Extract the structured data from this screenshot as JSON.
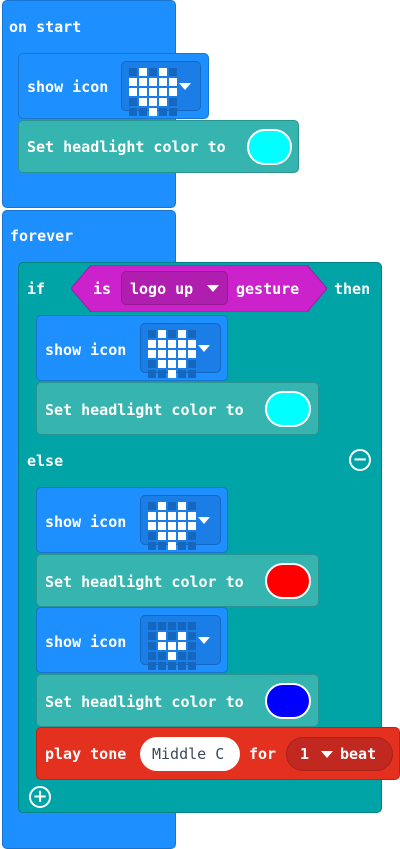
{
  "on_start": {
    "label": "on start",
    "show_icon": {
      "label": "show icon",
      "icon": "heart",
      "pattern": [
        0,
        1,
        0,
        1,
        0,
        1,
        1,
        1,
        1,
        1,
        1,
        1,
        1,
        1,
        1,
        0,
        1,
        1,
        1,
        0,
        0,
        0,
        1,
        0,
        0
      ]
    },
    "set_headlight": {
      "label": "Set headlight color to",
      "color": "#00ffff"
    }
  },
  "forever": {
    "label": "forever",
    "if_block": {
      "if_label": "if",
      "then_label": "then",
      "else_label": "else",
      "condition": {
        "is_label": "is",
        "gesture_value": "logo up",
        "gesture_label": "gesture"
      },
      "then_body": [
        {
          "show_icon": {
            "label": "show icon",
            "icon": "heart",
            "pattern": [
              0,
              1,
              0,
              1,
              0,
              1,
              1,
              1,
              1,
              1,
              1,
              1,
              1,
              1,
              1,
              0,
              1,
              1,
              1,
              0,
              0,
              0,
              1,
              0,
              0
            ]
          }
        },
        {
          "set_headlight": {
            "label": "Set headlight color to",
            "color": "#00ffff"
          }
        }
      ],
      "else_body": [
        {
          "show_icon": {
            "label": "show icon",
            "icon": "heart",
            "pattern": [
              0,
              1,
              0,
              1,
              0,
              1,
              1,
              1,
              1,
              1,
              1,
              1,
              1,
              1,
              1,
              0,
              1,
              1,
              1,
              0,
              0,
              0,
              1,
              0,
              0
            ]
          }
        },
        {
          "set_headlight": {
            "label": "Set headlight color to",
            "color": "#ff0000"
          }
        },
        {
          "show_icon": {
            "label": "show icon",
            "icon": "small-heart",
            "pattern": [
              0,
              0,
              0,
              0,
              0,
              0,
              1,
              0,
              1,
              0,
              0,
              1,
              1,
              1,
              0,
              0,
              0,
              1,
              0,
              0,
              0,
              0,
              0,
              0,
              0
            ]
          }
        },
        {
          "set_headlight": {
            "label": "Set headlight color to",
            "color": "#0000ff"
          }
        },
        {
          "play_tone": {
            "label": "play tone",
            "note": "Middle C",
            "for_label": "for",
            "beats": "1",
            "beat_label": "beat"
          }
        }
      ]
    }
  },
  "colors": {
    "blue": "#1e8fff",
    "teal": "#00a4a6",
    "headlight": "#36b4af",
    "music": "#e3301f",
    "gesture": "#cc22cc"
  }
}
